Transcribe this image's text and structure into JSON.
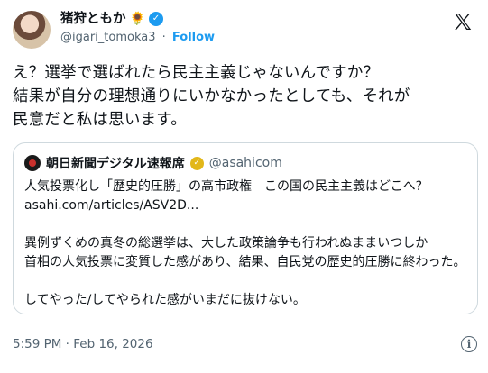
{
  "tweet": {
    "author_name": "猪狩ともか",
    "name_emoji": "🌻",
    "handle": "@igari_tomoka3",
    "separator": "·",
    "follow_label": "Follow",
    "text": "え？選挙で選ばれたら民主主義じゃないんですか？\n結果が自分の理想通りにいかなかったとしても、それが\n民意だと私は思います。",
    "timestamp": "5:59 PM · Feb 16, 2026"
  },
  "quote": {
    "author_name": "朝日新聞デジタル速報席",
    "handle": "@asahicom",
    "body": "人気投票化し「歴史的圧勝」の高市政権　この国の民主主義はどこへ?\nasahi.com/articles/ASV2D...\n\n異例ずくめの真冬の総選挙は、大した政策論争も行われぬままいつしか\n首相の人気投票に変質した感があり、結果、自民党の歴史的圧勝に終わった。\n\nしてやった/してやられた感がいまだに抜けない。"
  },
  "icons": {
    "verified": "blue-verified-badge-icon",
    "gold_verified": "gold-verified-badge-icon",
    "x_logo": "x-logo-icon",
    "info": "info-icon"
  },
  "colors": {
    "accent": "#1d9bf0",
    "secondary_text": "#536471",
    "border": "#cfd9de",
    "gold": "#e2b719"
  }
}
